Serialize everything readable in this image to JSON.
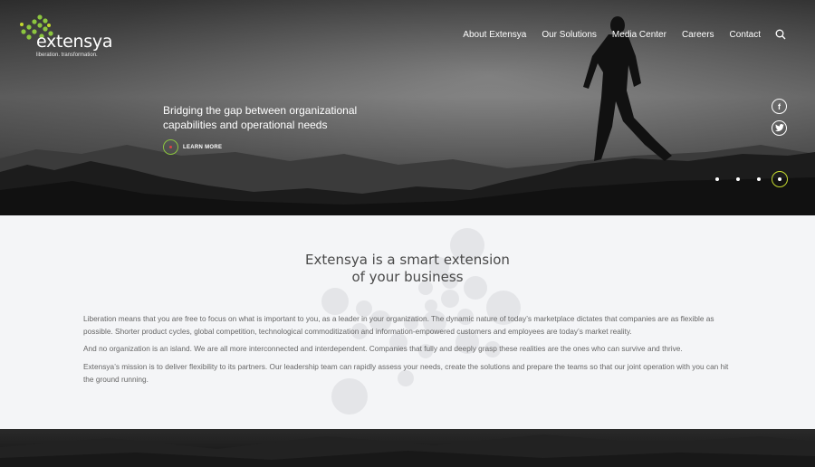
{
  "brand": {
    "name": "extensya",
    "tagline": "liberation. transformation.",
    "accent_green": "#8cc63f",
    "accent_yellow": "#c4d82e"
  },
  "nav": {
    "items": [
      {
        "label": "About Extensya"
      },
      {
        "label": "Our Solutions"
      },
      {
        "label": "Media Center"
      },
      {
        "label": "Careers"
      },
      {
        "label": "Contact"
      }
    ],
    "search_icon": "search-icon"
  },
  "hero": {
    "headline": "Bridging the gap between organizational capabilities and operational needs",
    "cta_label": "LEARN MORE",
    "social": [
      {
        "icon": "facebook-icon",
        "glyph": "f"
      },
      {
        "icon": "twitter-icon",
        "glyph": "t"
      }
    ],
    "slides": {
      "count": 4,
      "active": 4
    }
  },
  "intro": {
    "heading_line1": "Extensya is a smart extension",
    "heading_line2": "of your business",
    "paragraphs": [
      "Liberation means that you are free to focus on what is important to you, as a leader in your organization. The dynamic nature of today’s marketplace dictates that companies are as flexible as possible. Shorter product cycles, global competition, technological commoditization and information-empowered customers and employees are today’s market reality.",
      "And no organization is an island. We are all more interconnected and interdependent. Companies that fully and deeply grasp these realities are the ones who can survive and thrive.",
      "Extensya’s mission is to deliver flexibility to its partners. Our leadership team can rapidly assess your needs, create the solutions and prepare the teams so that our joint operation with you can hit the ground running."
    ]
  }
}
